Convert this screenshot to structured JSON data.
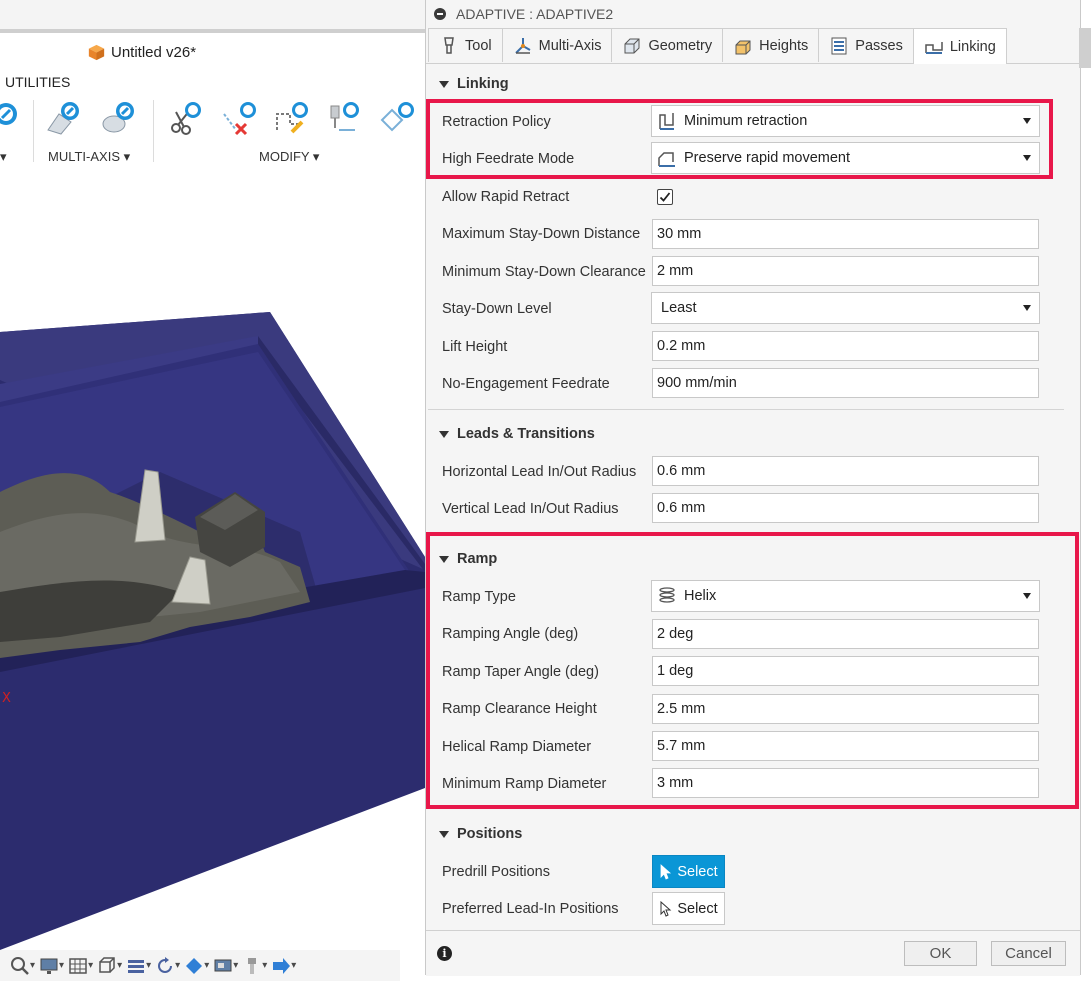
{
  "app": {
    "document_title": "Untitled v26*",
    "utilities_label": "UTILITIES",
    "groups": {
      "multi_axis": "MULTI-AXIS ▾",
      "modify": "MODIFY ▾"
    },
    "axis_marker": "X"
  },
  "dialog": {
    "title": "ADAPTIVE : ADAPTIVE2",
    "tabs": [
      {
        "label": "Tool",
        "icon": "tool-icon"
      },
      {
        "label": "Multi-Axis",
        "icon": "multi-axis-icon"
      },
      {
        "label": "Geometry",
        "icon": "geometry-icon"
      },
      {
        "label": "Heights",
        "icon": "heights-icon"
      },
      {
        "label": "Passes",
        "icon": "passes-icon"
      },
      {
        "label": "Linking",
        "icon": "linking-icon",
        "active": true
      }
    ],
    "linking": {
      "header": "Linking",
      "retraction_policy": {
        "label": "Retraction Policy",
        "value": "Minimum retraction",
        "icon": "minimum-retraction-icon"
      },
      "high_feedrate_mode": {
        "label": "High Feedrate Mode",
        "value": "Preserve rapid movement",
        "icon": "rapid-movement-icon"
      },
      "allow_rapid_retract": {
        "label": "Allow Rapid Retract",
        "checked": true
      },
      "max_stay_down_distance": {
        "label": "Maximum Stay-Down Distance",
        "value": "30 mm"
      },
      "min_stay_down_clearance": {
        "label": "Minimum Stay-Down Clearance",
        "value": "2 mm"
      },
      "stay_down_level": {
        "label": "Stay-Down Level",
        "value": "Least"
      },
      "lift_height": {
        "label": "Lift Height",
        "value": "0.2 mm"
      },
      "no_engagement_feedrate": {
        "label": "No-Engagement Feedrate",
        "value": "900 mm/min"
      }
    },
    "leads": {
      "header": "Leads & Transitions",
      "horizontal_radius": {
        "label": "Horizontal Lead In/Out Radius",
        "value": "0.6 mm"
      },
      "vertical_radius": {
        "label": "Vertical Lead In/Out Radius",
        "value": "0.6 mm"
      }
    },
    "ramp": {
      "header": "Ramp",
      "ramp_type": {
        "label": "Ramp Type",
        "value": "Helix",
        "icon": "helix-icon"
      },
      "ramping_angle": {
        "label": "Ramping Angle (deg)",
        "value": "2 deg"
      },
      "ramp_taper_angle": {
        "label": "Ramp Taper Angle (deg)",
        "value": "1 deg"
      },
      "ramp_clearance_height": {
        "label": "Ramp Clearance Height",
        "value": "2.5 mm"
      },
      "helical_ramp_diameter": {
        "label": "Helical Ramp Diameter",
        "value": "5.7 mm"
      },
      "minimum_ramp_diameter": {
        "label": "Minimum Ramp Diameter",
        "value": "3 mm"
      }
    },
    "positions": {
      "header": "Positions",
      "predrill": {
        "label": "Predrill Positions",
        "button": "Select"
      },
      "preferred_lead_in": {
        "label": "Preferred Lead-In Positions",
        "button": "Select"
      }
    },
    "footer": {
      "ok": "OK",
      "cancel": "Cancel"
    }
  },
  "colors": {
    "highlight": "#e8174a",
    "select_primary": "#0a96d6",
    "model_box": "#2c2c6e",
    "icon_blue": "#1e90d8"
  }
}
